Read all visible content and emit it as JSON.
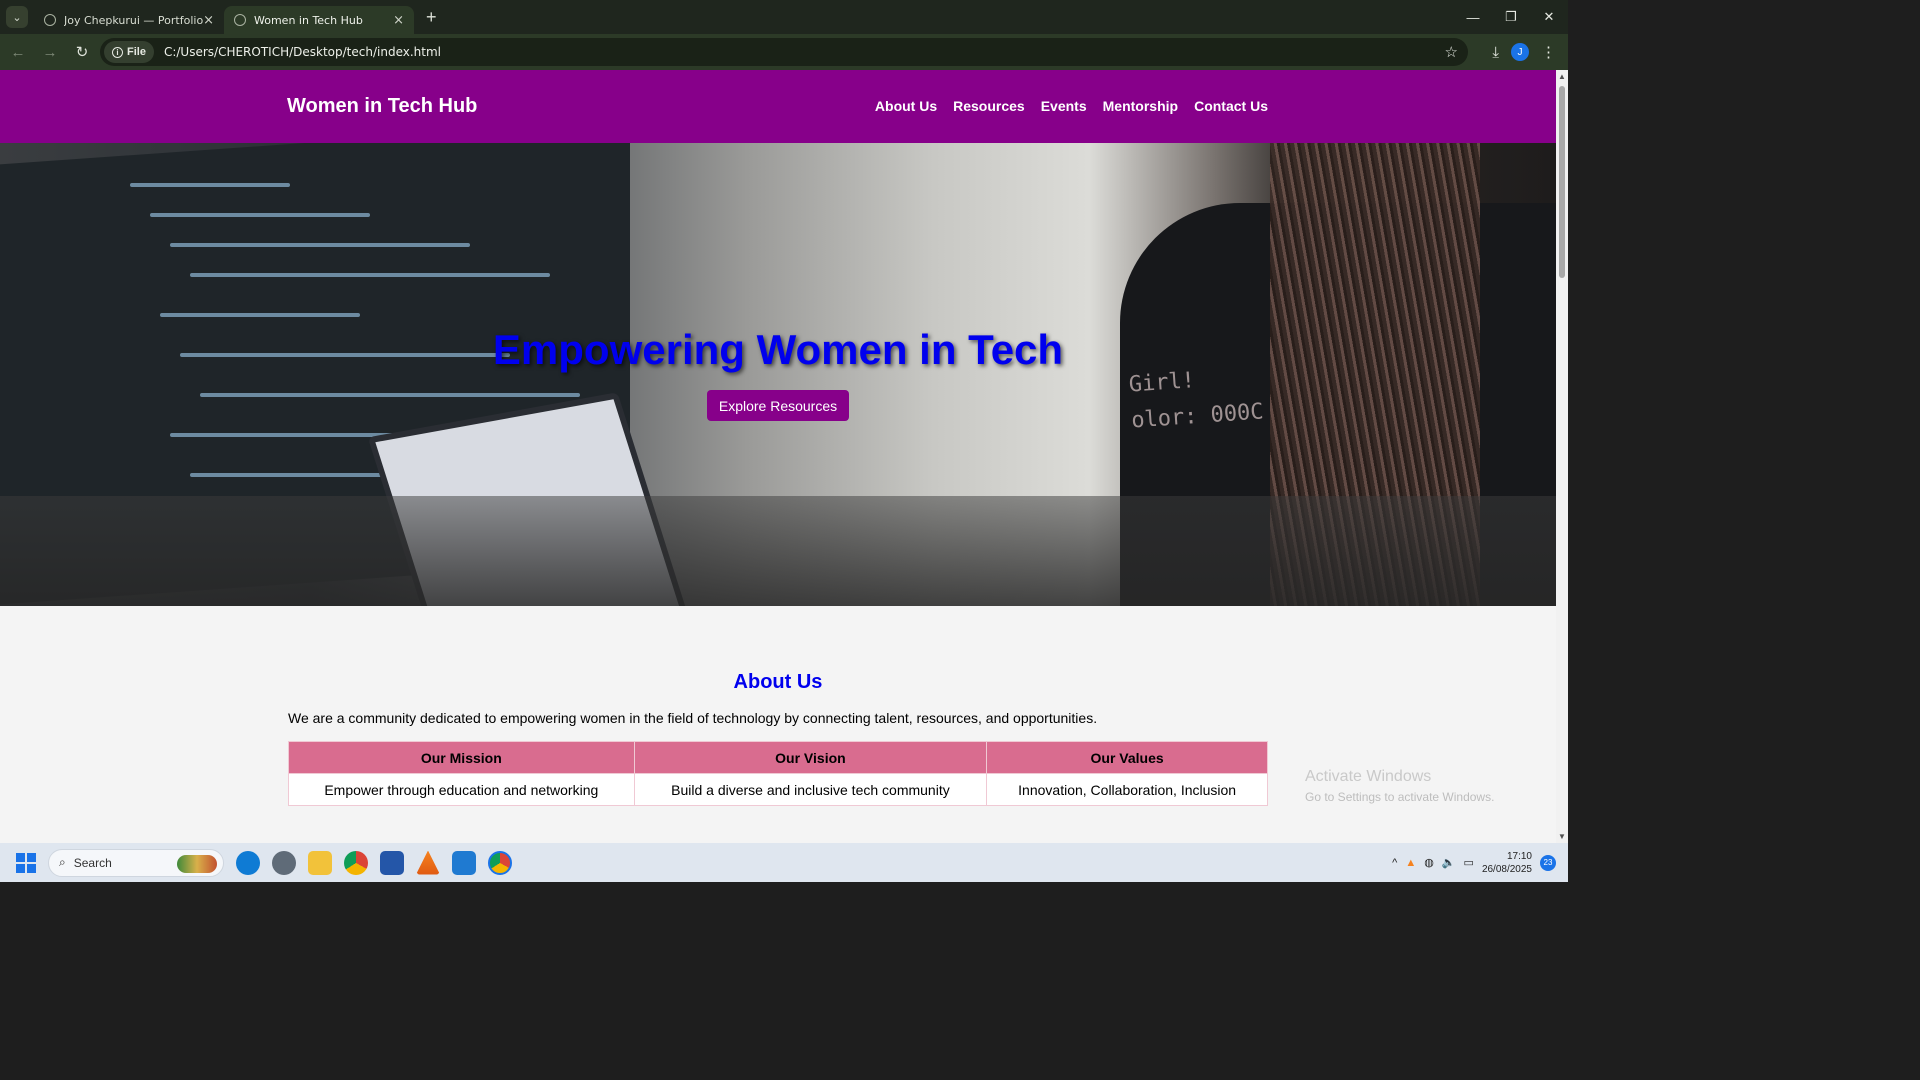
{
  "browser": {
    "tabs": [
      {
        "label": "Joy Chepkurui — Portfolio",
        "active": false
      },
      {
        "label": "Women in Tech Hub",
        "active": true
      }
    ],
    "new_tab": "+",
    "close_glyph": "×",
    "chip_label": "File",
    "url": "C:/Users/CHEROTICH/Desktop/tech/index.html",
    "profile_initial": "J"
  },
  "site": {
    "logo": "Women in Tech Hub",
    "nav": [
      "About Us",
      "Resources",
      "Events",
      "Mentorship",
      "Contact Us"
    ],
    "hero": {
      "title": "Empowering Women in Tech",
      "button": "Explore Resources",
      "shirt_text_1": "Girl!",
      "shirt_text_2": "olor: 000C"
    },
    "about": {
      "title": "About Us",
      "text": "We are a community dedicated to empowering women in the field of technology by connecting talent, resources, and opportunities.",
      "headers": [
        "Our Mission",
        "Our Vision",
        "Our Values"
      ],
      "cells": [
        "Empower through education and networking",
        "Build a diverse and inclusive tech community",
        "Innovation, Collaboration, Inclusion"
      ]
    }
  },
  "watermark": {
    "title": "Activate Windows",
    "sub": "Go to Settings to activate Windows."
  },
  "taskbar": {
    "search_placeholder": "Search",
    "time": "17:10",
    "date": "26/08/2025",
    "notifications": "23"
  },
  "colors": {
    "header_bg": "#87008a",
    "hero_title": "#0000ee",
    "table_header": "#d96c8f"
  }
}
